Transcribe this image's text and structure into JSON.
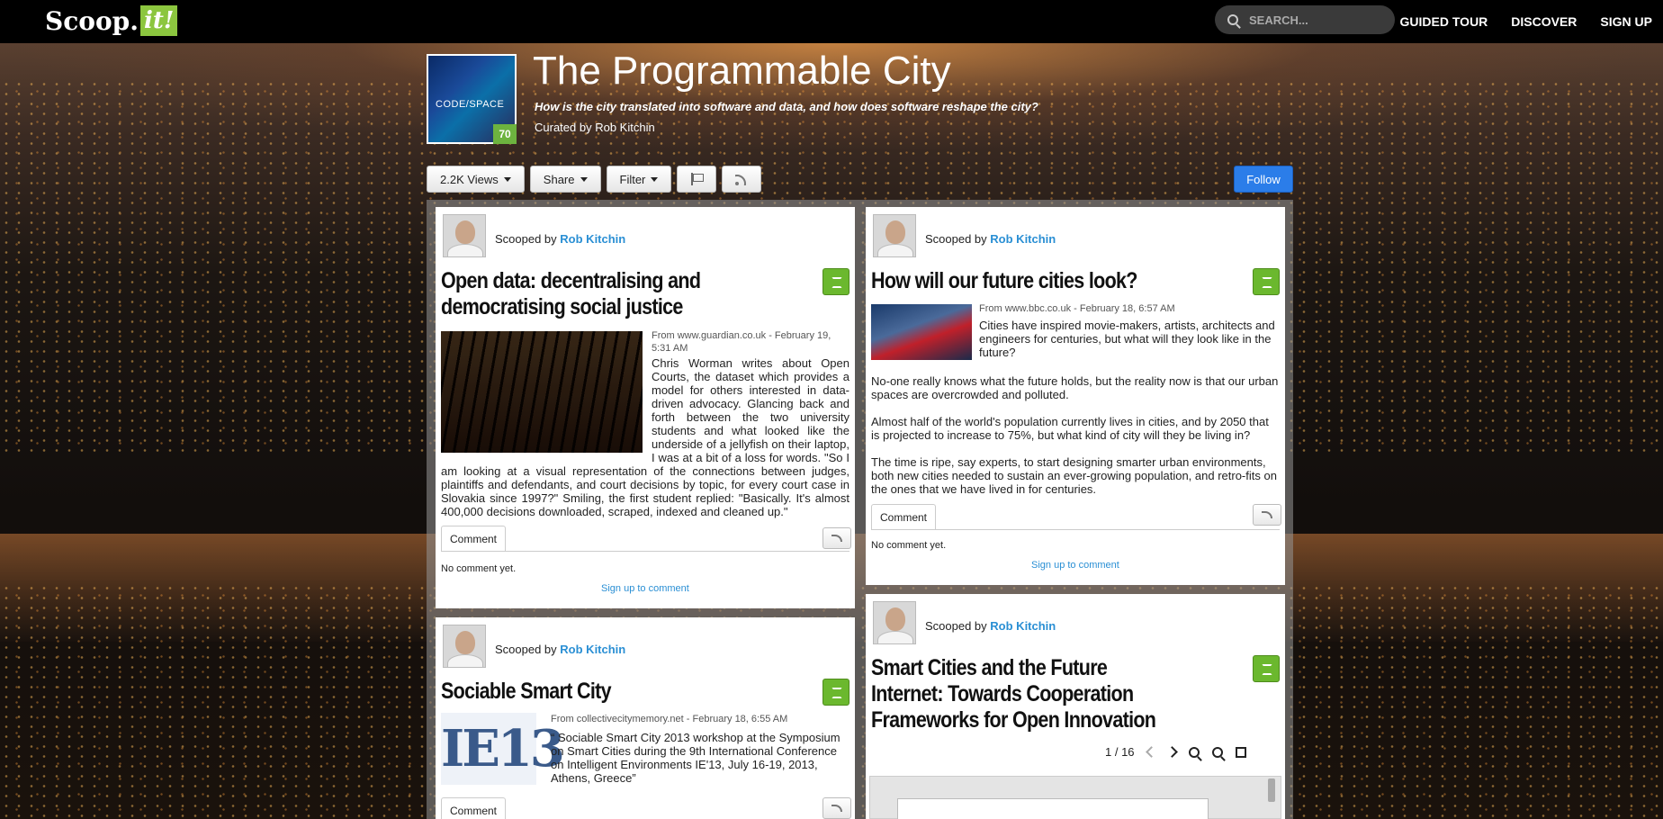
{
  "topbar": {
    "logo_main": "Scoop.",
    "logo_it": "it!",
    "search_placeholder": "SEARCH...",
    "nav": [
      "GUIDED TOUR",
      "DISCOVER",
      "SIGN UP"
    ]
  },
  "topic": {
    "cover_text": "CODE/SPACE",
    "score": "70",
    "title": "The Programmable City",
    "subtitle": "How is the city translated into software and data, and how does software reshape the city?",
    "curated_by": "Curated by Rob Kitchin"
  },
  "toolbar": {
    "views": "2.2K Views",
    "share": "Share",
    "filter": "Filter",
    "follow": "Follow"
  },
  "posts": [
    {
      "scooped_label": "Scooped by",
      "author": "Rob Kitchin",
      "title": "Open data: decentralising and democratising social justice",
      "source": "From www.guardian.co.uk - February 19, 5:31 AM",
      "body": "Chris Worman writes about Open Courts, the dataset which provides a model for others interested in data-driven advocacy.  Glancing back and forth between the two university students and what looked like the underside of a jellyfish on their laptop, I was at a bit of a loss for words. \"So I am looking at a visual representation of the connections between judges, plaintiffs and defendants, and court decisions by topic, for every court case in Slovakia since 1997?\" Smiling, the first student replied: \"Basically. It's almost 400,000 decisions downloaded, scraped, indexed and cleaned up.\"",
      "comment_tab": "Comment",
      "no_comment": "No comment yet.",
      "signup": "Sign up to comment"
    },
    {
      "scooped_label": "Scooped by",
      "author": "Rob Kitchin",
      "title": "How will our future cities look?",
      "source": "From www.bbc.co.uk - February 18, 6:57 AM",
      "lead": "Cities have inspired movie-makers, artists, architects and engineers for centuries, but what will they look like in the future?",
      "p1": "No-one really knows what the future holds, but the reality now is that our urban spaces are overcrowded and polluted.",
      "p2": "Almost half of the world's population currently lives in cities, and by 2050 that is projected to increase to 75%, but what kind of city will they be living in?",
      "p3": "The time is ripe, say experts, to start designing smarter urban environments, both new cities needed to sustain an ever-growing population, and retro-fits on the ones that we have lived in for centuries.",
      "comment_tab": "Comment",
      "no_comment": "No comment yet.",
      "signup": "Sign up to comment"
    },
    {
      "scooped_label": "Scooped by",
      "author": "Rob Kitchin",
      "title": "Sociable Smart City",
      "source": "From collectivecitymemory.net - February 18, 6:55 AM",
      "body": "“ Sociable Smart City 2013 workshop at the Symposium on Smart Cities during the 9th International Conference on Intelligent Environments IE'13, July 16-19, 2013, Athens, Greece”",
      "image_text": "IE13",
      "comment_tab": "Comment"
    },
    {
      "scooped_label": "Scooped by",
      "author": "Rob Kitchin",
      "title": "Smart Cities and the Future Internet: Towards Cooperation Frameworks for Open Innovation",
      "page_indicator": "1 / 16"
    }
  ]
}
